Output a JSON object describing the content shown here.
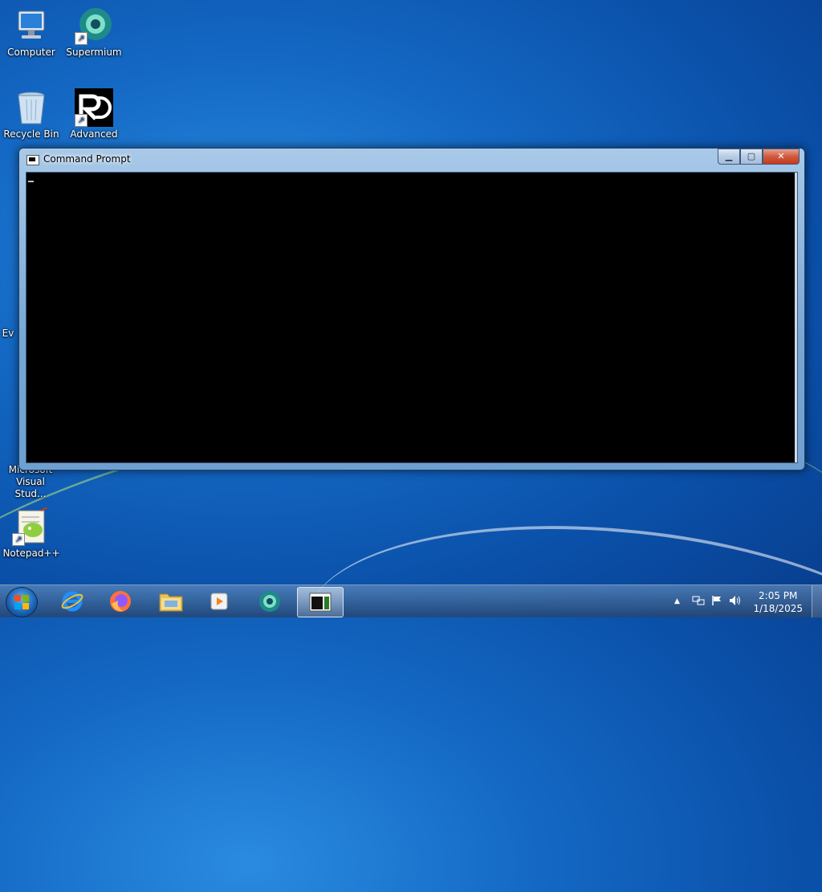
{
  "desktop": {
    "icons": [
      {
        "name": "computer",
        "label": "Computer"
      },
      {
        "name": "supermium",
        "label": "Supermium"
      },
      {
        "name": "recycle-bin",
        "label": "Recycle Bin"
      },
      {
        "name": "advanced",
        "label": "Advanced"
      },
      {
        "name": "ev-partial",
        "label": "Ev"
      },
      {
        "name": "visual-studio",
        "label": "Microsoft Visual Stud..."
      },
      {
        "name": "notepad-plus-plus",
        "label": "Notepad++"
      }
    ]
  },
  "window": {
    "title": "Command Prompt",
    "minimize_symbol": "▁",
    "maximize_symbol": "▢",
    "close_symbol": "✕"
  },
  "taskbar": {
    "items": [
      {
        "name": "internet-explorer",
        "icon": "ie-icon"
      },
      {
        "name": "firefox",
        "icon": "firefox-icon"
      },
      {
        "name": "file-explorer",
        "icon": "folder-icon"
      },
      {
        "name": "media-player",
        "icon": "media-player-icon"
      },
      {
        "name": "supermium",
        "icon": "supermium-icon"
      },
      {
        "name": "command-prompt",
        "icon": "cmd-icon",
        "active": true
      }
    ],
    "tray": {
      "show_hidden_symbol": "▲",
      "time": "2:05 PM",
      "date": "1/18/2025"
    }
  },
  "colors": {
    "desktop_bg": "#1469c4",
    "console_bg": "#000000",
    "title_bar": "#a9c9e8",
    "close_button": "#c7391c"
  }
}
